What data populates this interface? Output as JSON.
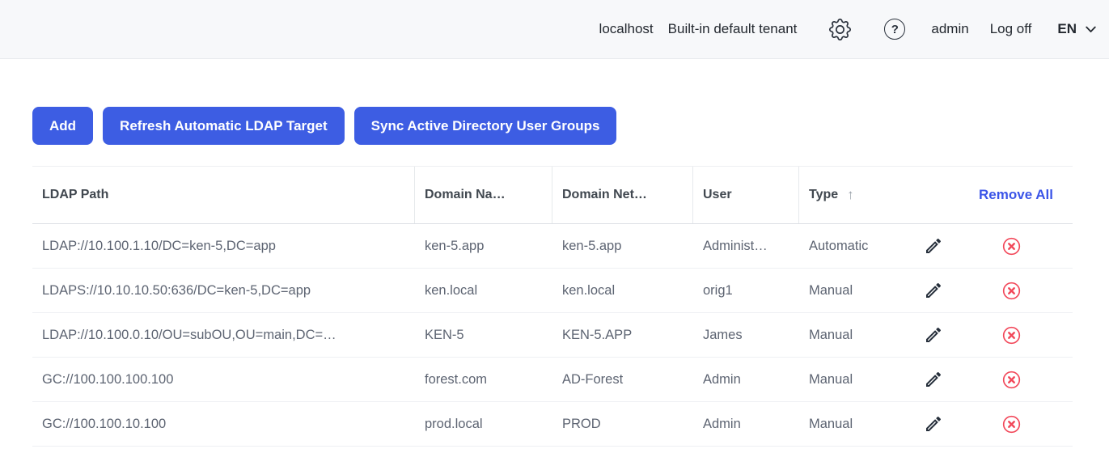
{
  "topbar": {
    "host": "localhost",
    "tenant": "Built-in default tenant",
    "help_glyph": "?",
    "user": "admin",
    "logoff_label": "Log off",
    "language": "EN"
  },
  "toolbar": {
    "add_label": "Add",
    "refresh_label": "Refresh Automatic LDAP Target",
    "sync_label": "Sync Active Directory User Groups"
  },
  "table": {
    "columns": {
      "ldap_path": "LDAP Path",
      "domain_name": "Domain Na…",
      "domain_netbios": "Domain Net…",
      "user": "User",
      "type": "Type",
      "type_sort_arrow": "↑",
      "remove_all": "Remove All"
    },
    "rows": [
      {
        "ldap_path": "LDAP://10.100.1.10/DC=ken-5,DC=app",
        "domain_name": "ken-5.app",
        "domain_netbios": "ken-5.app",
        "user": "Administ…",
        "type": "Automatic"
      },
      {
        "ldap_path": "LDAPS://10.10.10.50:636/DC=ken-5,DC=app",
        "domain_name": "ken.local",
        "domain_netbios": "ken.local",
        "user": "orig1",
        "type": "Manual"
      },
      {
        "ldap_path": "LDAP://10.100.0.10/OU=subOU,OU=main,DC=…",
        "domain_name": "KEN-5",
        "domain_netbios": "KEN-5.APP",
        "user": "James",
        "type": "Manual"
      },
      {
        "ldap_path": "GC://100.100.100.100",
        "domain_name": "forest.com",
        "domain_netbios": "AD-Forest",
        "user": "Admin",
        "type": "Manual"
      },
      {
        "ldap_path": "GC://100.100.10.100",
        "domain_name": "prod.local",
        "domain_netbios": "PROD",
        "user": "Admin",
        "type": "Manual"
      }
    ]
  },
  "colors": {
    "primary_blue": "#3d5de3",
    "link_blue": "#3b55e8",
    "danger_red": "#f2485a",
    "icon_dark": "#262f3b",
    "topbar_bg": "#f7f8fa"
  }
}
